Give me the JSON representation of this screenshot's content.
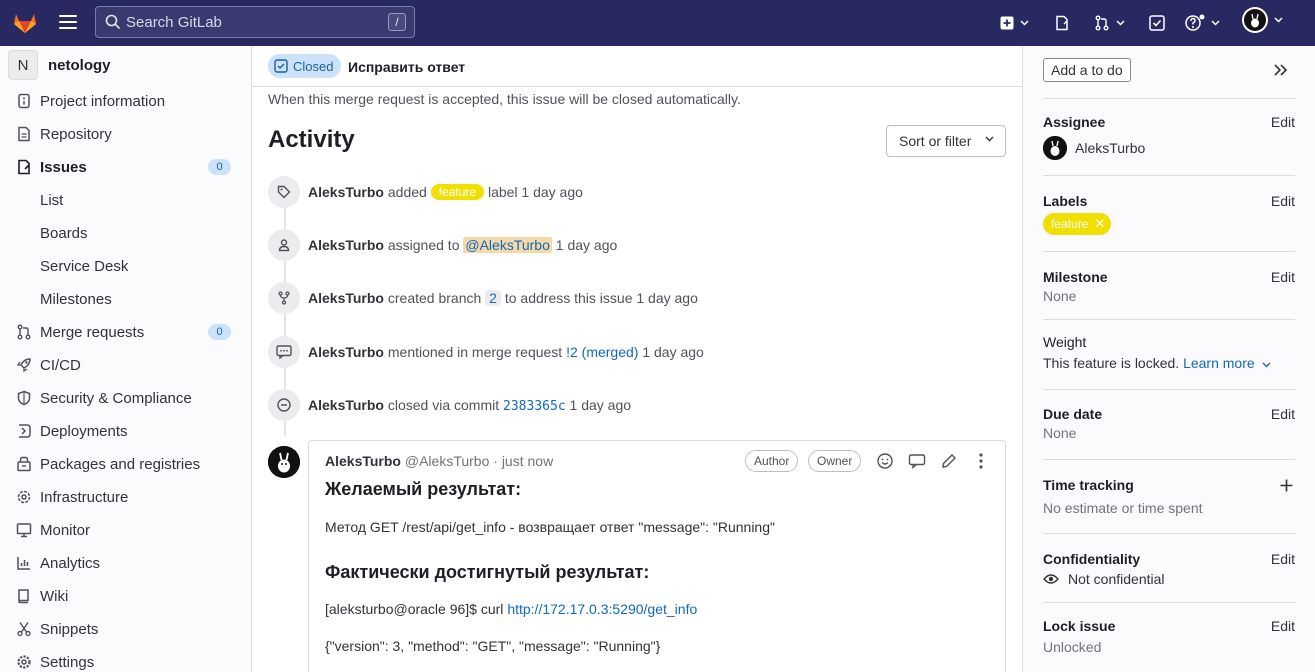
{
  "topbar": {
    "search_placeholder": "Search GitLab",
    "search_shortcut": "/"
  },
  "sidebar": {
    "project_initial": "N",
    "project_name": "netology",
    "items": [
      {
        "label": "Project information",
        "icon": "info-icon"
      },
      {
        "label": "Repository",
        "icon": "doc-icon"
      },
      {
        "label": "Issues",
        "icon": "issues-icon",
        "count": "0"
      },
      {
        "label": "List"
      },
      {
        "label": "Boards"
      },
      {
        "label": "Service Desk"
      },
      {
        "label": "Milestones"
      },
      {
        "label": "Merge requests",
        "icon": "merge-request-icon",
        "count": "0"
      },
      {
        "label": "CI/CD",
        "icon": "rocket-icon"
      },
      {
        "label": "Security & Compliance",
        "icon": "shield-icon"
      },
      {
        "label": "Deployments",
        "icon": "deployments-icon"
      },
      {
        "label": "Packages and registries",
        "icon": "package-icon"
      },
      {
        "label": "Infrastructure",
        "icon": "cloud-gear-icon"
      },
      {
        "label": "Monitor",
        "icon": "monitor-icon"
      },
      {
        "label": "Analytics",
        "icon": "chart-icon"
      },
      {
        "label": "Wiki",
        "icon": "book-icon"
      },
      {
        "label": "Snippets",
        "icon": "scissors-icon"
      },
      {
        "label": "Settings",
        "icon": "gear-icon"
      }
    ]
  },
  "main": {
    "closed_badge": "Closed",
    "mr_title": "Исправить ответ",
    "info_line": "When this merge request is accepted, this issue will be closed automatically.",
    "activity_heading": "Activity",
    "sort_button": "Sort or filter",
    "timeline": {
      "t1": {
        "user": "AleksTurbo",
        "pre": "added",
        "label": "feature",
        "post": "label 1 day ago"
      },
      "t2": {
        "user": "AleksTurbo",
        "pre": "assigned to",
        "mention": "@AleksTurbo",
        "post": "1 day ago"
      },
      "t3": {
        "user": "AleksTurbo",
        "pre": "created branch",
        "branch": "2",
        "post": "to address this issue 1 day ago"
      },
      "t4": {
        "user": "AleksTurbo",
        "pre": "mentioned in merge request",
        "link": "!2 (merged)",
        "post": "1 day ago"
      },
      "t5": {
        "user": "AleksTurbo",
        "pre": "closed via commit",
        "commit": "2383365c",
        "post": "1 day ago"
      }
    },
    "note": {
      "author": "AleksTurbo",
      "handle": "@AleksTurbo · just now",
      "badge_author": "Author",
      "badge_owner": "Owner",
      "h1": "Желаемый результат:",
      "p1": "Метод GET /rest/api/get_info - возвращает ответ \"message\": \"Running\"",
      "h2": "Фактически достигнутый результат:",
      "p2_prefix": "[aleksturbo@oracle 96]$ curl",
      "p2_link": "http://172.17.0.3:5290/get_info",
      "p3": "{\"version\": 3, \"method\": \"GET\", \"message\": \"Running\"}"
    }
  },
  "right": {
    "todo": "Add a to do",
    "assignee_title": "Assignee",
    "edit": "Edit",
    "assignee_name": "AleksTurbo",
    "labels_title": "Labels",
    "label_chip": "feature",
    "milestone_title": "Milestone",
    "milestone_val": "None",
    "weight_title": "Weight",
    "weight_val": "This feature is locked.",
    "learn_more": "Learn more",
    "due_title": "Due date",
    "due_val": "None",
    "time_title": "Time tracking",
    "time_val": "No estimate or time spent",
    "conf_title": "Confidentiality",
    "conf_val": "Not confidential",
    "lock_title": "Lock issue",
    "lock_val": "Unlocked"
  },
  "colors": {
    "topbar": "#292961",
    "label_feature": "#f0df00",
    "link": "#1068bf"
  }
}
